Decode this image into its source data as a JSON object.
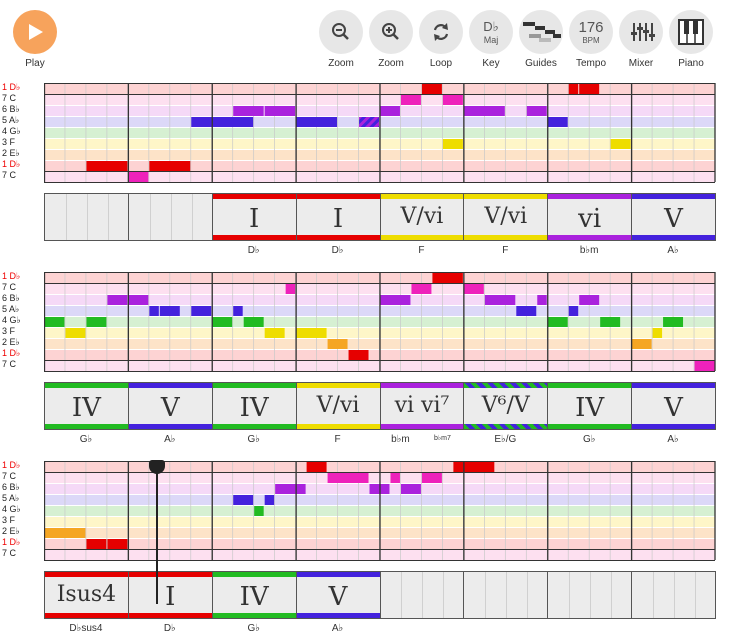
{
  "toolbar": {
    "play_label": "Play",
    "zoom_out_label": "Zoom",
    "zoom_in_label": "Zoom",
    "loop_label": "Loop",
    "key_label": "Key",
    "key_value_top": "D♭",
    "key_value_bottom": "Maj",
    "guides_label": "Guides",
    "tempo_label": "Tempo",
    "tempo_value": "176",
    "tempo_unit": "BPM",
    "mixer_label": "Mixer",
    "piano_label": "Piano"
  },
  "row_labels": [
    "1 D♭",
    "7 C",
    "6 B♭",
    "5 A♭",
    "4 G♭",
    "3 F",
    "2 E♭",
    "1 D♭",
    "7 C"
  ],
  "row_label_colors": [
    "red",
    "",
    "",
    "",
    "",
    "",
    "",
    "red",
    ""
  ],
  "row_colors": [
    "#fdd3d3",
    "#fde0f0",
    "#f5d9f7",
    "#dcd8f8",
    "#d6f0d2",
    "#fef6c8",
    "#fde3c8",
    "#fdd3d3",
    "#fde0f0"
  ],
  "note_colors": {
    "1": "#e60000",
    "7": "#ee22bb",
    "6": "#aa22dd",
    "5": "#4422dd",
    "4": "#22bb22",
    "3": "#eedd00",
    "2": "#f5a623"
  },
  "sections": [
    {
      "notes": [
        {
          "row": 7,
          "s": 4,
          "e": 8
        },
        {
          "row": 8,
          "s": 8,
          "e": 10
        },
        {
          "row": 7,
          "s": 10,
          "e": 14
        },
        {
          "row": 3,
          "s": 14,
          "e": 20
        },
        {
          "row": 2,
          "s": 18,
          "e": 21
        },
        {
          "row": 2,
          "s": 21,
          "e": 24
        },
        {
          "row": 3,
          "s": 24,
          "e": 28
        },
        {
          "row": 3,
          "s": 30,
          "e": 32,
          "stripe": true
        },
        {
          "row": 2,
          "s": 32,
          "e": 34
        },
        {
          "row": 1,
          "s": 34,
          "e": 36
        },
        {
          "row": 0,
          "s": 36,
          "e": 38
        },
        {
          "row": 1,
          "s": 38,
          "e": 40
        },
        {
          "row": 5,
          "s": 38,
          "e": 40
        },
        {
          "row": 2,
          "s": 40,
          "e": 44
        },
        {
          "row": 2,
          "s": 46,
          "e": 48
        },
        {
          "row": 3,
          "s": 48,
          "e": 50
        },
        {
          "row": 0,
          "s": 50,
          "e": 51
        },
        {
          "row": 0,
          "s": 51,
          "e": 53
        },
        {
          "row": 5,
          "s": 54,
          "e": 56
        }
      ],
      "chords": [
        {
          "text": "",
          "name": "",
          "bar": "",
          "empty": true
        },
        {
          "text": "",
          "name": "",
          "bar": "",
          "empty": true
        },
        {
          "text": "I",
          "name": "D♭",
          "bar": "#e60000"
        },
        {
          "text": "I",
          "name": "D♭",
          "bar": "#e60000"
        },
        {
          "text": "V/vi",
          "name": "F",
          "bar": "#eedd00"
        },
        {
          "text": "V/vi",
          "name": "F",
          "bar": "#eedd00"
        },
        {
          "text": "vi",
          "name": "b♭m",
          "bar": "#aa22dd"
        },
        {
          "text": "V",
          "name": "A♭",
          "bar": "#4422dd"
        }
      ]
    },
    {
      "notes": [
        {
          "row": 4,
          "s": 0,
          "e": 2
        },
        {
          "row": 5,
          "s": 2,
          "e": 4
        },
        {
          "row": 4,
          "s": 4,
          "e": 6
        },
        {
          "row": 2,
          "s": 6,
          "e": 8
        },
        {
          "row": 2,
          "s": 8,
          "e": 10
        },
        {
          "row": 3,
          "s": 10,
          "e": 11
        },
        {
          "row": 3,
          "s": 11,
          "e": 13
        },
        {
          "row": 3,
          "s": 14,
          "e": 16
        },
        {
          "row": 4,
          "s": 16,
          "e": 18
        },
        {
          "row": 3,
          "s": 18,
          "e": 19
        },
        {
          "row": 4,
          "s": 19,
          "e": 21
        },
        {
          "row": 5,
          "s": 21,
          "e": 23
        },
        {
          "row": 1,
          "s": 23,
          "e": 24
        },
        {
          "row": 5,
          "s": 24,
          "e": 27
        },
        {
          "row": 6,
          "s": 27,
          "e": 29
        },
        {
          "row": 7,
          "s": 29,
          "e": 31
        },
        {
          "row": 2,
          "s": 32,
          "e": 35
        },
        {
          "row": 1,
          "s": 35,
          "e": 37
        },
        {
          "row": 0,
          "s": 37,
          "e": 40
        },
        {
          "row": 1,
          "s": 40,
          "e": 42
        },
        {
          "row": 2,
          "s": 42,
          "e": 45
        },
        {
          "row": 3,
          "s": 45,
          "e": 47
        },
        {
          "row": 2,
          "s": 47,
          "e": 48
        },
        {
          "row": 4,
          "s": 48,
          "e": 50
        },
        {
          "row": 3,
          "s": 50,
          "e": 51
        },
        {
          "row": 2,
          "s": 51,
          "e": 53
        },
        {
          "row": 4,
          "s": 53,
          "e": 55
        },
        {
          "row": 6,
          "s": 56,
          "e": 58
        },
        {
          "row": 5,
          "s": 58,
          "e": 59
        },
        {
          "row": 4,
          "s": 59,
          "e": 61
        },
        {
          "row": 8,
          "s": 62,
          "e": 64
        }
      ],
      "chords": [
        {
          "text": "IV",
          "name": "G♭",
          "bar": "#22bb22"
        },
        {
          "text": "V",
          "name": "A♭",
          "bar": "#4422dd"
        },
        {
          "text": "IV",
          "name": "G♭",
          "bar": "#22bb22"
        },
        {
          "text": "V/vi",
          "name": "F",
          "bar": "#eedd00"
        },
        {
          "text": "vi vi⁷",
          "name": "b♭m",
          "name2": "b♭m7",
          "bar": "#aa22dd",
          "half": true
        },
        {
          "text": "V⁶/V",
          "name": "E♭/G",
          "bar": "stripe"
        },
        {
          "text": "IV",
          "name": "G♭",
          "bar": "#22bb22"
        },
        {
          "text": "V",
          "name": "A♭",
          "bar": "#4422dd"
        }
      ]
    },
    {
      "notes": [
        {
          "row": 6,
          "s": 0,
          "e": 4
        },
        {
          "row": 7,
          "s": 4,
          "e": 6
        },
        {
          "row": 7,
          "s": 6,
          "e": 8
        },
        {
          "row": 3,
          "s": 18,
          "e": 20
        },
        {
          "row": 4,
          "s": 20,
          "e": 21
        },
        {
          "row": 3,
          "s": 21,
          "e": 22
        },
        {
          "row": 2,
          "s": 22,
          "e": 25
        },
        {
          "row": 0,
          "s": 25,
          "e": 27
        },
        {
          "row": 1,
          "s": 27,
          "e": 31
        },
        {
          "row": 2,
          "s": 31,
          "e": 33
        },
        {
          "row": 1,
          "s": 33,
          "e": 34
        },
        {
          "row": 2,
          "s": 34,
          "e": 36
        },
        {
          "row": 1,
          "s": 36,
          "e": 38
        },
        {
          "row": 0,
          "s": 39,
          "e": 43
        }
      ],
      "chords": [
        {
          "text": "Isus4",
          "name": "D♭sus4",
          "bar": "#e60000"
        },
        {
          "text": "I",
          "name": "D♭",
          "bar": "#e60000"
        },
        {
          "text": "IV",
          "name": "G♭",
          "bar": "#22bb22"
        },
        {
          "text": "V",
          "name": "A♭",
          "bar": "#4422dd"
        },
        {
          "text": "",
          "name": "",
          "bar": "",
          "empty": true
        },
        {
          "text": "",
          "name": "",
          "bar": "",
          "empty": true
        },
        {
          "text": "",
          "name": "",
          "bar": "",
          "empty": true
        },
        {
          "text": "",
          "name": "",
          "bar": "",
          "empty": true
        }
      ]
    }
  ]
}
